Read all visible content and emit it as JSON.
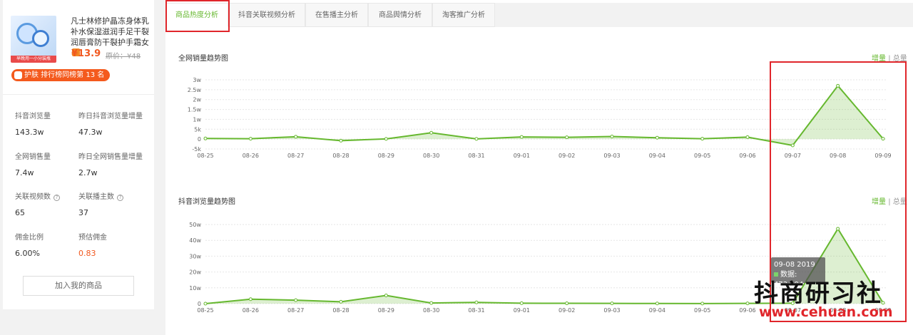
{
  "product": {
    "title": "凡士林修护晶冻身体乳补水保湿滋润手足干裂润唇膏防干裂护手霜女",
    "price": "¥13.9",
    "original_price": "原价：¥48",
    "thumb_ribbon": "早晚用一小分装瓶",
    "rank": "护肤 排行榜同榜第 13 名"
  },
  "stats": [
    {
      "label": "抖音浏览量",
      "value": "143.3w"
    },
    {
      "label": "昨日抖音浏览量增量",
      "value": "47.3w"
    },
    {
      "label": "全网销售量",
      "value": "7.4w"
    },
    {
      "label": "昨日全网销售量增量",
      "value": "2.7w"
    },
    {
      "label": "关联视频数",
      "value": "65",
      "hint": "?"
    },
    {
      "label": "关联播主数",
      "value": "37",
      "hint": "?"
    },
    {
      "label": "佣金比例",
      "value": "6.00%"
    },
    {
      "label": "预估佣金",
      "value": "0.83",
      "color": "#f1581f"
    }
  ],
  "add_button": "加入我的商品",
  "tabs": [
    "商品热度分析",
    "抖音关联视频分析",
    "在售播主分析",
    "商品舆情分析",
    "淘客推广分析"
  ],
  "toggle": {
    "increment": "增量",
    "sep": "|",
    "total": "总量"
  },
  "accent_color": "#66b82f",
  "tooltip": {
    "date": "09-08 2019",
    "label": "数据: 473,194"
  },
  "watermark": {
    "cn": "抖商研习社",
    "url": "www.cehuan.com"
  },
  "chart_data": [
    {
      "type": "area",
      "title": "全网销量趋势图",
      "x": [
        "08-25",
        "08-26",
        "08-27",
        "08-28",
        "08-29",
        "08-30",
        "08-31",
        "09-01",
        "09-02",
        "09-03",
        "09-04",
        "09-05",
        "09-06",
        "09-07",
        "09-08",
        "09-09"
      ],
      "values": [
        300,
        200,
        1200,
        -800,
        100,
        3200,
        100,
        1100,
        900,
        1300,
        700,
        200,
        1000,
        -3200,
        27000,
        200
      ],
      "ylim": [
        -5000,
        30000
      ],
      "yticks": [
        "-5k",
        "0",
        "5k",
        "1w",
        "1.5w",
        "2w",
        "2.5w",
        "3w"
      ],
      "ytick_values": [
        -5000,
        0,
        5000,
        10000,
        15000,
        20000,
        25000,
        30000
      ]
    },
    {
      "type": "area",
      "title": "抖音浏览量趋势图",
      "x": [
        "08-25",
        "08-26",
        "08-27",
        "08-28",
        "08-29",
        "08-30",
        "08-31",
        "09-01",
        "09-02",
        "09-03",
        "09-04",
        "09-05",
        "09-06",
        "09-07",
        "09-08",
        "09-09"
      ],
      "values": [
        0,
        28000,
        22000,
        12000,
        52000,
        4000,
        8000,
        3000,
        2000,
        1500,
        1000,
        500,
        1500,
        3000,
        473194,
        5000
      ],
      "ylim": [
        0,
        500000
      ],
      "yticks": [
        "0",
        "10w",
        "20w",
        "30w",
        "40w",
        "50w"
      ],
      "ytick_values": [
        0,
        100000,
        200000,
        300000,
        400000,
        500000
      ]
    }
  ]
}
